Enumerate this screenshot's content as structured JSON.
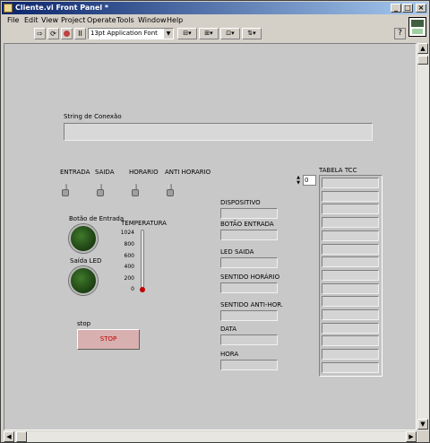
{
  "window": {
    "title": "Cliente.vi Front Panel *"
  },
  "menu": [
    "File",
    "Edit",
    "View",
    "Project",
    "Operate",
    "Tools",
    "Window",
    "Help"
  ],
  "toolbar": {
    "font": "13pt Application Font"
  },
  "panel": {
    "string_label": "String de Conexão",
    "switches": [
      "ENTRADA",
      "SAIDA",
      "HORARIO",
      "ANTI HORARIO"
    ],
    "led_entrada_label": "Botão de Entrada",
    "led_saida_label": "Saída LED",
    "thermo": {
      "label": "TEMPERATURA",
      "ticks": [
        "1024",
        "800",
        "600",
        "400",
        "200",
        "0"
      ],
      "value": 0
    },
    "stop_label": "stop",
    "stop_button": "STOP",
    "indicators": [
      "DISPOSITIVO",
      "BOTÃO ENTRADA",
      "LED SAIDA",
      "SENTIDO HORÁRIO",
      "SENTIDO ANTI-HOR.",
      "DATA",
      "HORA"
    ],
    "array_label": "TABELA TCC",
    "array_index": "0"
  },
  "colors": {
    "titlebar": "#0a246a",
    "led_off": "#2c5a1e",
    "stop_text": "#c00000"
  }
}
